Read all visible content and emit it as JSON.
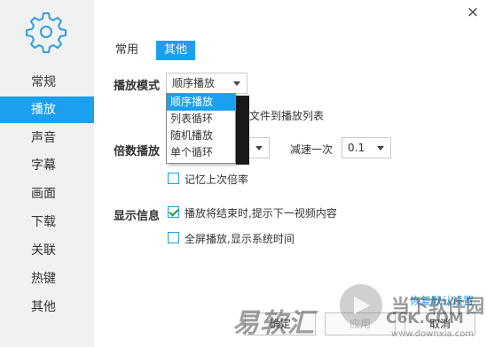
{
  "sidebar": {
    "items": [
      {
        "label": "常规"
      },
      {
        "label": "播放"
      },
      {
        "label": "声音"
      },
      {
        "label": "字幕"
      },
      {
        "label": "画面"
      },
      {
        "label": "下载"
      },
      {
        "label": "关联"
      },
      {
        "label": "热键"
      },
      {
        "label": "其他"
      }
    ],
    "active_index": 1
  },
  "window": {
    "close_glyph": "×"
  },
  "tabs": [
    {
      "label": "常用"
    },
    {
      "label": "其他"
    }
  ],
  "play_mode": {
    "label": "播放模式",
    "selected": "顺序播放",
    "options": [
      "顺序播放",
      "列表循环",
      "随机播放",
      "单个循环"
    ],
    "add_files_text": "文件到播放列表"
  },
  "speed": {
    "label": "倍数播放",
    "decrease_label": "减速一次",
    "decrease_value": "0.1",
    "remember_label": "记忆上次倍率",
    "remember_checked": false
  },
  "display": {
    "label": "显示信息",
    "near_end_label": "播放将结束时,提示下一视频内容",
    "near_end_checked": true,
    "fullscreen_time_label": "全屏播放,显示系统时间",
    "fullscreen_time_checked": false
  },
  "footer": {
    "restore_link": "恢复默认设置",
    "ok": "确定",
    "apply": "应用",
    "cancel": "取消"
  },
  "watermark": {
    "brand": "易软汇",
    "site_logo_text": "当下软件园",
    "site_url": "www.downxia.com",
    "site_short": "C6K.COM"
  },
  "colors": {
    "accent": "#1aa0ee",
    "sidebar_bg": "#f1f1f1"
  }
}
